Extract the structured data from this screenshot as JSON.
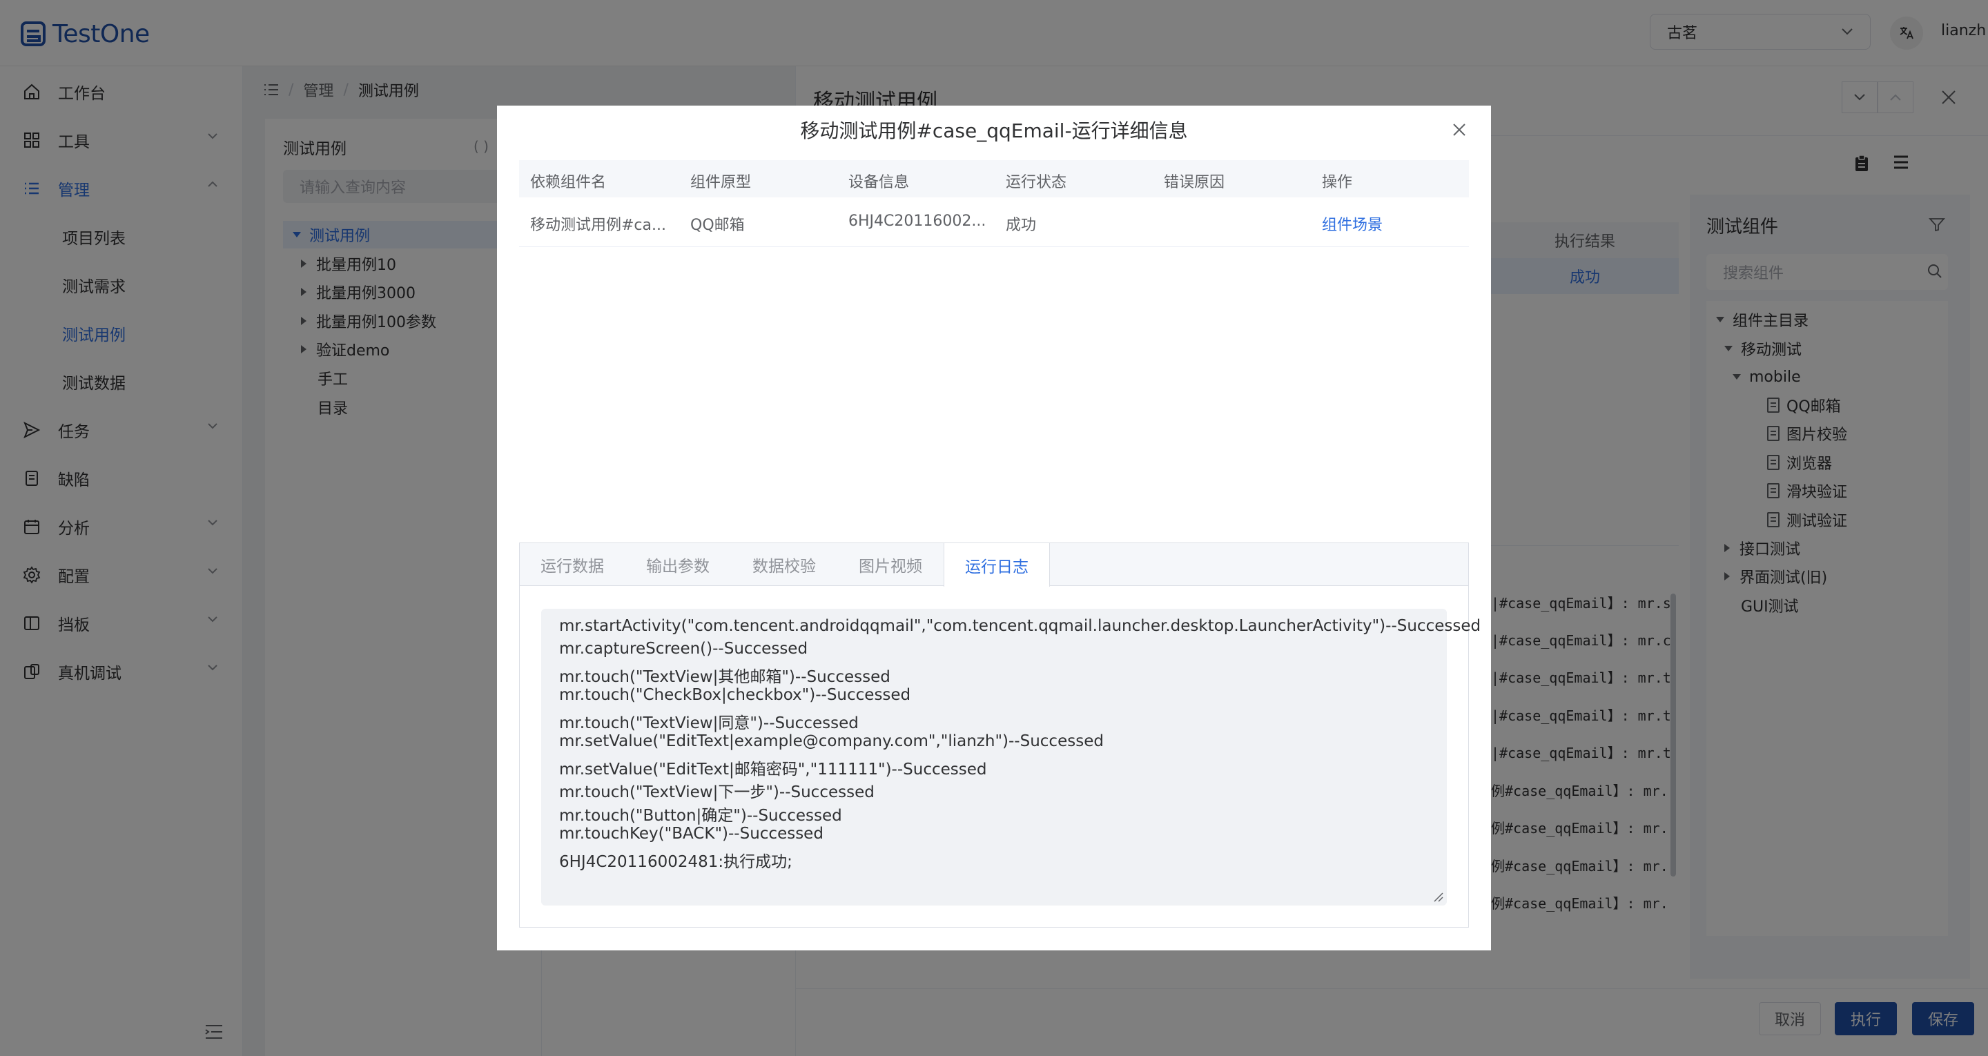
{
  "app": {
    "name": "TestOne",
    "brand_color": "#2150a8",
    "accent_color": "#2f6fe0"
  },
  "header": {
    "project": "古茗",
    "user": "lianzh",
    "lang_icon": "translate-icon"
  },
  "sidebar": {
    "items": [
      {
        "label": "工作台",
        "icon": "home-icon"
      },
      {
        "label": "工具",
        "icon": "grid-icon"
      },
      {
        "label": "管理",
        "icon": "list-icon"
      },
      {
        "label": "任务",
        "icon": "send-icon"
      },
      {
        "label": "缺陷",
        "icon": "document-icon"
      },
      {
        "label": "分析",
        "icon": "calendar-icon"
      },
      {
        "label": "配置",
        "icon": "gear-icon"
      },
      {
        "label": "挡板",
        "icon": "panel-icon"
      },
      {
        "label": "真机调试",
        "icon": "device-icon"
      }
    ],
    "sub_items": [
      "项目列表",
      "测试需求",
      "测试用例",
      "测试数据"
    ]
  },
  "breadcrumb": {
    "items": [
      "管理",
      "测试用例"
    ]
  },
  "case_panel": {
    "title": "测试用例",
    "search_placeholder": "请输入查询内容",
    "tree": [
      "测试用例",
      "批量用例10",
      "批量用例3000",
      "批量用例100参数",
      "验证demo",
      "手工",
      "目录"
    ]
  },
  "drawer": {
    "title": "移动测试用例",
    "result_header": "执行结果",
    "result_value": "成功",
    "log_lines": [
      "|#case_qqEmail】: mr.s",
      "|#case_qqEmail】: mr.c",
      "|#case_qqEmail】: mr.t",
      "|#case_qqEmail】: mr.t",
      "|#case_qqEmail】: mr.t",
      "例#case_qqEmail】: mr.",
      "例#case_qqEmail】: mr.",
      "例#case_qqEmail】: mr.",
      "例#case_qqEmail】: mr."
    ],
    "buttons": {
      "cancel": "取消",
      "run": "执行",
      "save": "保存"
    }
  },
  "components": {
    "title": "测试组件",
    "search_placeholder": "搜索组件",
    "tree": {
      "root": "组件主目录",
      "mobile_test": "移动测试",
      "mobile": "mobile",
      "files": [
        "QQ邮箱",
        "图片校验",
        "浏览器",
        "滑块验证",
        "测试验证"
      ],
      "api_test": "接口测试",
      "ui_test": "界面测试(旧)",
      "gui_test": "GUI测试"
    }
  },
  "dialog": {
    "title": "移动测试用例#case_qqEmail-运行详细信息",
    "columns": [
      "依赖组件名",
      "组件原型",
      "设备信息",
      "运行状态",
      "错误原因",
      "操作"
    ],
    "rows": [
      {
        "name": "移动测试用例#ca...",
        "prototype": "QQ邮箱",
        "device": "6HJ4C20116002...",
        "status": "成功",
        "error": "",
        "action": "组件场景"
      }
    ],
    "tabs": [
      "运行数据",
      "输出参数",
      "数据校验",
      "图片视频",
      "运行日志"
    ],
    "active_tab": "运行日志",
    "log": [
      "mr.startActivity(\"com.tencent.androidqqmail\",\"com.tencent.qqmail.launcher.desktop.LauncherActivity\")--Successed",
      "mr.captureScreen()--Successed",
      "mr.touch(\"TextView|其他邮箱\")--Successed",
      "mr.touch(\"CheckBox|checkbox\")--Successed",
      "mr.touch(\"TextView|同意\")--Successed",
      "mr.setValue(\"EditText|example@company.com\",\"lianzh\")--Successed",
      "mr.setValue(\"EditText|邮箱密码\",\"111111\")--Successed",
      "mr.touch(\"TextView|下一步\")--Successed",
      "mr.touch(\"Button|确定\")--Successed",
      "mr.touchKey(\"BACK\")--Successed",
      "6HJ4C20116002481:执行成功;"
    ]
  }
}
